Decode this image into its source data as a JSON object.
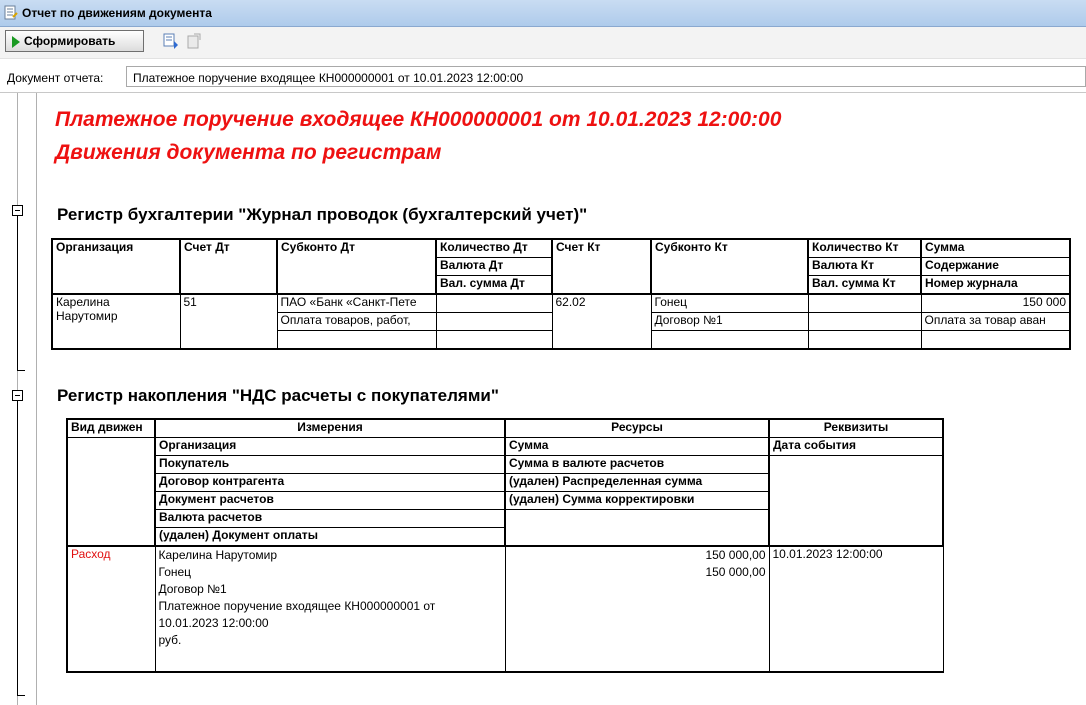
{
  "window": {
    "title": "Отчет по движениям документа"
  },
  "toolbar": {
    "generate_label": "Сформировать"
  },
  "doc_field": {
    "label": "Документ отчета:",
    "value": "Платежное поручение входящее КН000000001 от 10.01.2023 12:00:00"
  },
  "report": {
    "title1": "Платежное поручение входящее КН000000001 от 10.01.2023 12:00:00",
    "title2": "Движения документа по регистрам"
  },
  "register1": {
    "title": "Регистр бухгалтерии \"Журнал проводок (бухгалтерский учет)\"",
    "headers": {
      "org": "Организация",
      "acc_dt": "Счет Дт",
      "subconto_dt": "Субконто Дт",
      "qty_dt": "Количество Дт",
      "cur_dt": "Валюта Дт",
      "cur_sum_dt": "Вал. сумма Дт",
      "acc_kt": "Счет Кт",
      "subconto_kt": "Субконто Кт",
      "qty_kt": "Количество Кт",
      "cur_kt": "Валюта Кт",
      "cur_sum_kt": "Вал. сумма Кт",
      "sum": "Сумма",
      "content": "Содержание",
      "journal_no": "Номер журнала"
    },
    "row": {
      "org": "Карелина Нарутомир",
      "org_line1": "Карелина",
      "org_line2": "Нарутомир",
      "acc_dt": "51",
      "subconto_dt_1": "ПАО «Банк «Санкт-Пете",
      "subconto_dt_2": "Оплата товаров, работ,",
      "acc_kt": "62.02",
      "subconto_kt_1": "Гонец",
      "subconto_kt_2": "Договор №1",
      "sum": "150 000",
      "content": "Оплата за товар аван"
    }
  },
  "register2": {
    "title": "Регистр накопления \"НДС расчеты с покупателями\"",
    "headers": {
      "movement_type": "Вид движен",
      "dimensions": "Измерения",
      "resources": "Ресурсы",
      "attributes": "Реквизиты",
      "dims": [
        "Организация",
        "Покупатель",
        "Договор контрагента",
        "Документ расчетов",
        "Валюта расчетов",
        "(удален) Документ оплаты"
      ],
      "res": [
        "Сумма",
        "Сумма в валюте расчетов",
        "(удален) Распределенная сумма",
        "(удален) Сумма корректировки"
      ],
      "attrs": [
        "Дата события"
      ]
    },
    "row": {
      "movement_type": "Расход",
      "dims": [
        "Карелина Нарутомир",
        "Гонец",
        "Договор №1",
        "Платежное поручение входящее КН000000001 от",
        "10.01.2023 12:00:00",
        "руб."
      ],
      "res": [
        "150 000,00",
        "150 000,00"
      ],
      "event_date": "10.01.2023 12:00:00"
    }
  },
  "colors": {
    "title_red": "#ee1111",
    "movement_red": "#e01010",
    "play_green": "#1a9a22"
  }
}
